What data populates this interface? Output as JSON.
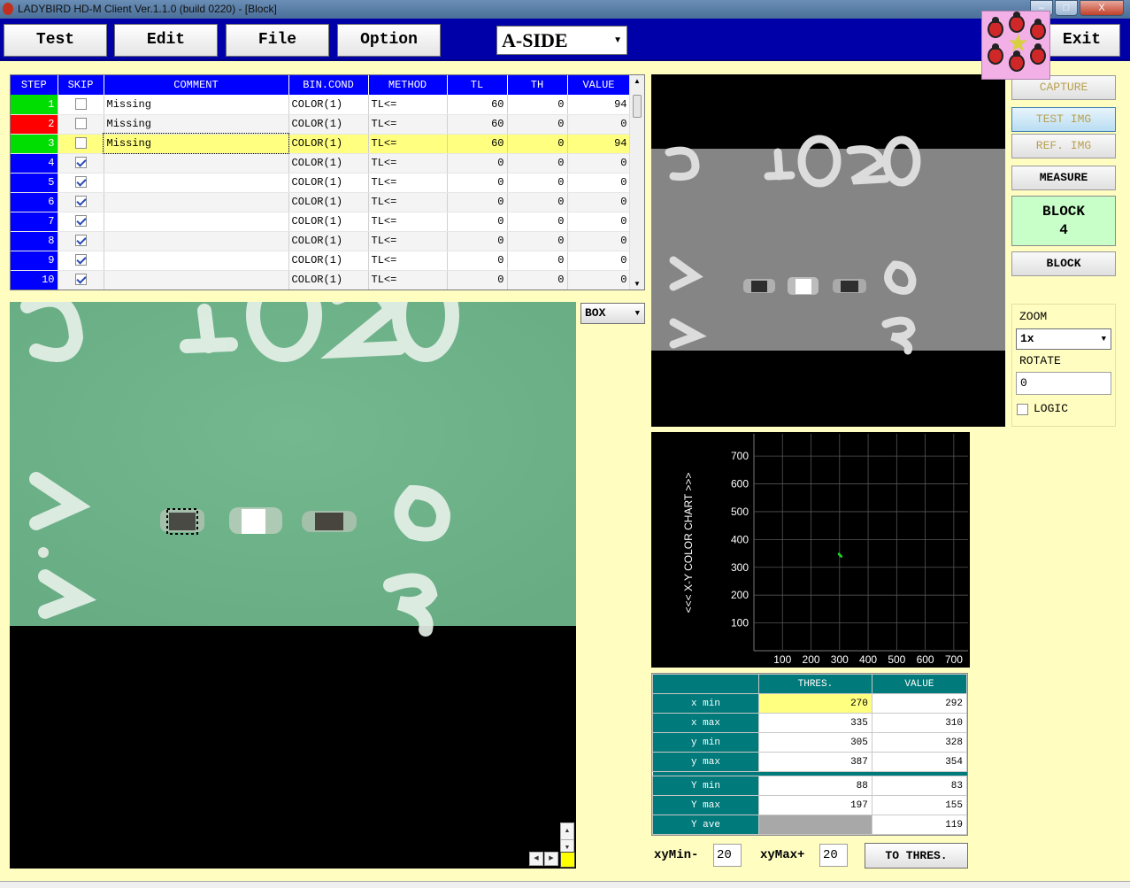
{
  "window": {
    "title": "LADYBIRD HD-M Client Ver.1.1.0  (build 0220) - [Block]",
    "min": "–",
    "max": "□",
    "close": "X"
  },
  "toolbar": {
    "test": "Test",
    "edit": "Edit",
    "file": "File",
    "option": "Option",
    "exit": "Exit",
    "side": "A-SIDE"
  },
  "grid": {
    "headers": [
      "STEP",
      "SKIP",
      "COMMENT",
      "BIN.COND",
      "METHOD",
      "TL",
      "TH",
      "VALUE"
    ],
    "rows": [
      {
        "step": "1",
        "skip": false,
        "comment": "Missing",
        "bin": "COLOR(1)",
        "method": "TL<=",
        "tl": "60",
        "th": "0",
        "value": "94",
        "status": "#00dd00"
      },
      {
        "step": "2",
        "skip": false,
        "comment": "Missing",
        "bin": "COLOR(1)",
        "method": "TL<=",
        "tl": "60",
        "th": "0",
        "value": "0",
        "status": "#ff0000"
      },
      {
        "step": "3",
        "skip": false,
        "comment": "Missing",
        "bin": "COLOR(1)",
        "method": "TL<=",
        "tl": "60",
        "th": "0",
        "value": "94",
        "status": "#00dd00"
      },
      {
        "step": "4",
        "skip": true,
        "comment": "",
        "bin": "COLOR(1)",
        "method": "TL<=",
        "tl": "0",
        "th": "0",
        "value": "0",
        "status": "#0000ff"
      },
      {
        "step": "5",
        "skip": true,
        "comment": "",
        "bin": "COLOR(1)",
        "method": "TL<=",
        "tl": "0",
        "th": "0",
        "value": "0",
        "status": "#0000ff"
      },
      {
        "step": "6",
        "skip": true,
        "comment": "",
        "bin": "COLOR(1)",
        "method": "TL<=",
        "tl": "0",
        "th": "0",
        "value": "0",
        "status": "#0000ff"
      },
      {
        "step": "7",
        "skip": true,
        "comment": "",
        "bin": "COLOR(1)",
        "method": "TL<=",
        "tl": "0",
        "th": "0",
        "value": "0",
        "status": "#0000ff"
      },
      {
        "step": "8",
        "skip": true,
        "comment": "",
        "bin": "COLOR(1)",
        "method": "TL<=",
        "tl": "0",
        "th": "0",
        "value": "0",
        "status": "#0000ff"
      },
      {
        "step": "9",
        "skip": true,
        "comment": "",
        "bin": "COLOR(1)",
        "method": "TL<=",
        "tl": "0",
        "th": "0",
        "value": "0",
        "status": "#0000ff"
      },
      {
        "step": "10",
        "skip": true,
        "comment": "",
        "bin": "COLOR(1)",
        "method": "TL<=",
        "tl": "0",
        "th": "0",
        "value": "0",
        "status": "#0000ff"
      }
    ],
    "selected_row": 3
  },
  "image": {
    "shape_select": "BOX",
    "board_text_top": "1020",
    "board_digit_right": "6",
    "board_digit_bottom": "3",
    "board_digit_left": "7"
  },
  "right": {
    "capture": "CAPTURE",
    "test_img": "TEST IMG",
    "ref_img": "REF. IMG",
    "measure": "MEASURE",
    "block_label": "BLOCK",
    "block_number": "4",
    "block_button": "BLOCK",
    "zoom_label": "ZOOM",
    "zoom_value": "1x",
    "rotate_label": "ROTATE",
    "rotate_value": "0",
    "logic_label": "LOGIC"
  },
  "chart_data": {
    "type": "scatter",
    "title": "<<<  X-Y COLOR CHART  >>>",
    "xticks": [
      "100",
      "200",
      "300",
      "400",
      "500",
      "600",
      "700"
    ],
    "yticks": [
      "100",
      "200",
      "300",
      "400",
      "500",
      "600",
      "700"
    ],
    "xlim": [
      0,
      750
    ],
    "ylim": [
      0,
      780
    ],
    "grid": true,
    "points": [
      {
        "x": 300,
        "y": 345
      },
      {
        "x": 303,
        "y": 342
      },
      {
        "x": 306,
        "y": 339
      },
      {
        "x": 298,
        "y": 348
      }
    ],
    "point_color": "#22cc22"
  },
  "thres": {
    "headers": [
      "",
      "THRES.",
      "VALUE"
    ],
    "rows_top": [
      {
        "label": "x min",
        "thres": "270",
        "value": "292"
      },
      {
        "label": "x max",
        "thres": "335",
        "value": "310"
      },
      {
        "label": "y min",
        "thres": "305",
        "value": "328"
      },
      {
        "label": "y max",
        "thres": "387",
        "value": "354"
      }
    ],
    "rows_bottom": [
      {
        "label": "Y min",
        "thres": "88",
        "value": "83"
      },
      {
        "label": "Y max",
        "thres": "197",
        "value": "155"
      },
      {
        "label": "Y ave",
        "thres": "",
        "value": "119"
      }
    ]
  },
  "bottom": {
    "xymin_label": "xyMin-",
    "xymin_value": "20",
    "xymax_label": "xyMax+",
    "xymax_value": "20",
    "to_thres": "TO THRES."
  }
}
